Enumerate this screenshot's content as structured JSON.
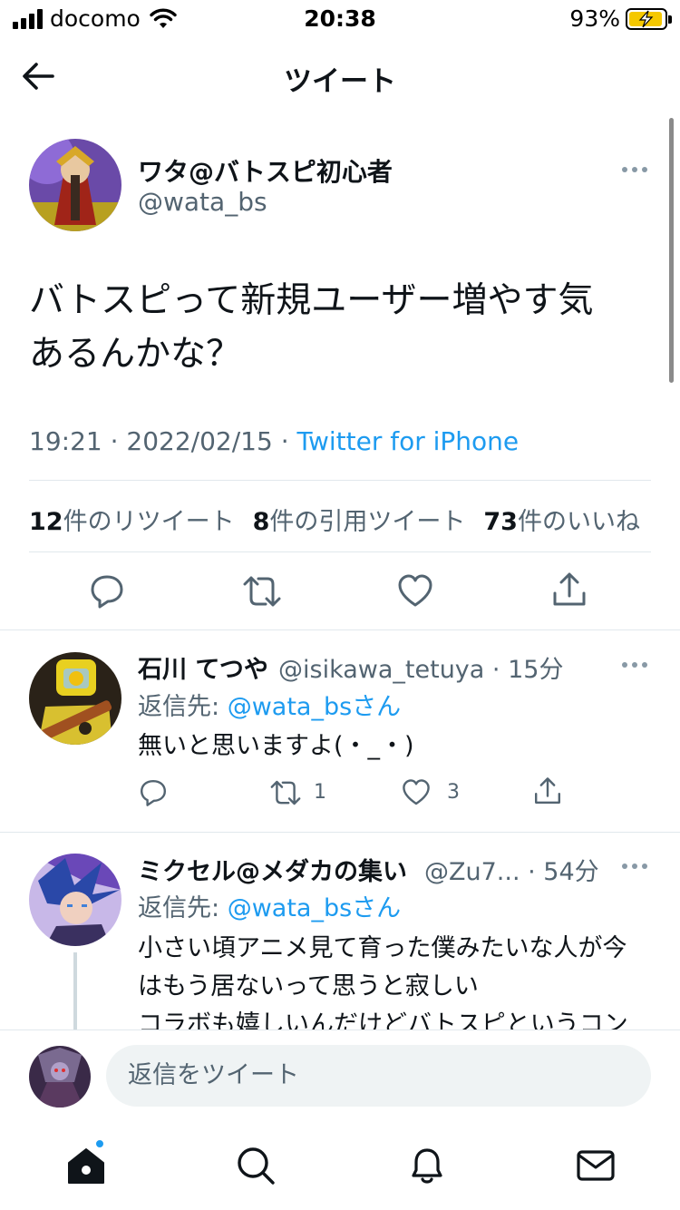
{
  "status_bar": {
    "carrier": "docomo",
    "time": "20:38",
    "battery": "93%"
  },
  "header": {
    "title": "ツイート"
  },
  "main_tweet": {
    "name": "ワタ@バトスピ初心者",
    "handle": "@wata_bs",
    "text_line1": "バトスピって新規ユーザー増やす気",
    "text_line2": "あるんかな？",
    "time": "19:21",
    "date": "2022/02/15",
    "source": "Twitter for iPhone",
    "sep": " · ",
    "retweets_count": "12",
    "retweets_label": "件のリツイート",
    "quotes_count": "8",
    "quotes_label": "件の引用ツイート",
    "likes_count": "73",
    "likes_label": "件のいいね"
  },
  "replies": [
    {
      "name": "石川 てつや",
      "handle": "@isikawa_tetuya",
      "time": "· 15分",
      "reply_prefix": "返信先: ",
      "reply_target": "@wata_bsさん",
      "text": "無いと思いますよ(・_・)",
      "retweets": "1",
      "likes": "3"
    },
    {
      "name": "ミクセル@メダカの集い",
      "handle": "@Zu7...",
      "time": "· 54分",
      "reply_prefix": "返信先: ",
      "reply_target": "@wata_bsさん",
      "text_line1": "小さい頃アニメ見て育った僕みたいな人が今",
      "text_line2": "はもう居ないって思うと寂しい",
      "text_line3": "コラボも嬉しいんだけどバトスピというコン"
    }
  ],
  "compose": {
    "placeholder": "返信をツイート"
  },
  "tabs": [
    "home-icon",
    "search-icon",
    "bell-icon",
    "mail-icon"
  ],
  "colors": {
    "accent": "#1d9bf0",
    "muted": "#536471",
    "text": "#0f1419",
    "divider": "#e1e8ed"
  }
}
